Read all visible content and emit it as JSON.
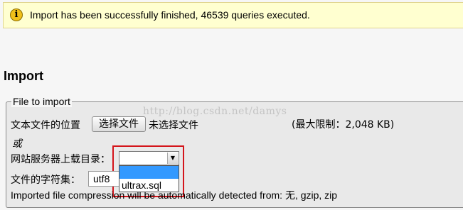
{
  "notice": {
    "icon": "info-icon",
    "text": "Import has been successfully finished, 46539 queries executed."
  },
  "page_title": "Import",
  "file_to_import": {
    "legend": "File to import",
    "local_file_label": "文本文件的位置",
    "choose_file_button": "选择文件",
    "no_file_chosen": "未选择文件",
    "max_limit": "(最大限制：2,048 KB)",
    "or_text": "或",
    "server_dir_label": "网站服务器上载目录：",
    "server_dir_selected": "",
    "server_dir_options": [
      "",
      "ultrax.sql"
    ],
    "charset_label": "文件的字符集：",
    "charset_value": "utf8",
    "compression_note": "Imported file compression will be automatically detected from: 无, gzip, zip"
  },
  "watermark": "http://blog.csdn.net/damys"
}
